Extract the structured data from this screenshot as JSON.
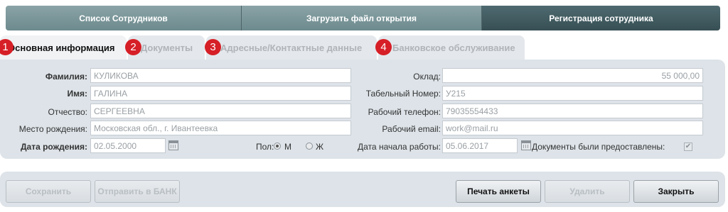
{
  "top_tabs": [
    {
      "label": "Список Сотрудников"
    },
    {
      "label": "Загрузить файл открытия"
    },
    {
      "label": "Регистрация сотрудника"
    }
  ],
  "sub_tabs": [
    {
      "num": "1",
      "label": "Основная информация"
    },
    {
      "num": "2",
      "label": "Документы"
    },
    {
      "num": "3",
      "label": "Адресные/Контактные данные"
    },
    {
      "num": "4",
      "label": "Банковское обслуживание"
    }
  ],
  "form": {
    "surname": {
      "label": "Фамилия:",
      "value": "КУЛИКОВА"
    },
    "name": {
      "label": "Имя:",
      "value": "ГАЛИНА"
    },
    "patronymic": {
      "label": "Отчество:",
      "value": "СЕРГЕЕВНА"
    },
    "birthplace": {
      "label": "Место рождения:",
      "value": "Московская обл., г. Ивантеевка"
    },
    "birthdate": {
      "label": "Дата рождения:",
      "value": "02.05.2000"
    },
    "gender": {
      "label": "Пол:",
      "male": "М",
      "female": "Ж",
      "selected": "М"
    },
    "salary": {
      "label": "Оклад:",
      "value": "55 000,00"
    },
    "tab_number": {
      "label": "Табельный Номер:",
      "value": "У215"
    },
    "work_phone": {
      "label": "Рабочий телефон:",
      "value": "79035554433"
    },
    "work_email": {
      "label": "Рабочий email:",
      "value": "work@mail.ru"
    },
    "start_date": {
      "label": "Дата начала работы:",
      "value": "05.06.2017"
    },
    "docs_provided": {
      "label": "Документы были предоставлены:",
      "checked": true,
      "mark": "✔"
    }
  },
  "buttons": {
    "save": "Сохранить",
    "send_bank": "Отправить в БАНК",
    "print": "Печать анкеты",
    "delete": "Удалить",
    "close": "Закрыть"
  }
}
